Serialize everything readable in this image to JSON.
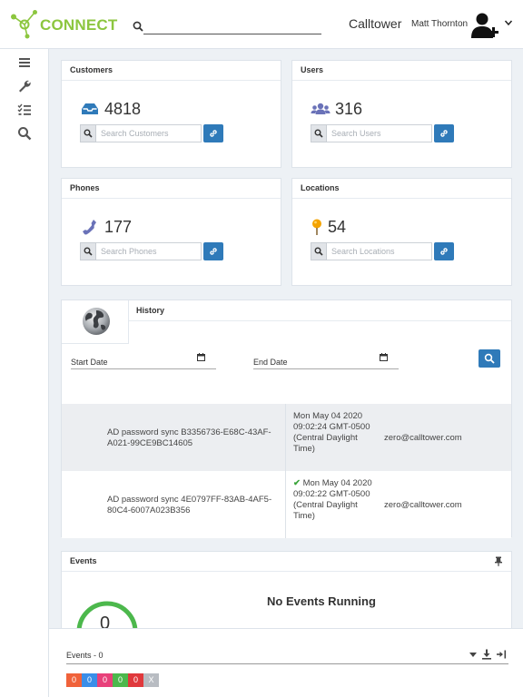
{
  "header": {
    "logo_text": "CONNECT",
    "search_placeholder": "",
    "brand": "Calltower",
    "user_name": "Matt Thornton"
  },
  "sidebar": {
    "items": [
      {
        "icon": "menu-icon"
      },
      {
        "icon": "wrench-icon"
      },
      {
        "icon": "checklist-icon"
      },
      {
        "icon": "search-icon"
      }
    ]
  },
  "stats": {
    "customers": {
      "title": "Customers",
      "value": "4818",
      "placeholder": "Search Customers",
      "icon": "inbox-icon"
    },
    "users": {
      "title": "Users",
      "value": "316",
      "placeholder": "Search Users",
      "icon": "users-icon"
    },
    "phones": {
      "title": "Phones",
      "value": "177",
      "placeholder": "Search Phones",
      "icon": "phone-icon"
    },
    "locations": {
      "title": "Locations",
      "value": "54",
      "placeholder": "Search Locations",
      "icon": "pin-icon"
    }
  },
  "history": {
    "title": "History",
    "start_date_label": "Start Date",
    "end_date_label": "End Date",
    "rows": [
      {
        "desc": "AD password sync B3356736-E68C-43AF-A021-99CE9BC14605",
        "check": "",
        "date": "Mon May 04 2020 09:02:24 GMT-0500 (Central Daylight Time)",
        "email": "zero@calltower.com"
      },
      {
        "desc": "AD password sync 4E0797FF-83AB-4AF5-80C4-6007A023B356",
        "check": "✔",
        "date": "Mon May 04 2020 09:02:22 GMT-0500 (Central Daylight Time)",
        "email": "zero@calltower.com"
      }
    ]
  },
  "events": {
    "title": "Events",
    "message": "No Events Running",
    "gauge_value": "0"
  },
  "footer": {
    "label": "Events - 0",
    "badges": [
      {
        "value": "0",
        "color": "#f0623a"
      },
      {
        "value": "0",
        "color": "#3a8ee8"
      },
      {
        "value": "0",
        "color": "#e8407a"
      },
      {
        "value": "0",
        "color": "#4cb84c"
      },
      {
        "value": "0",
        "color": "#e0383c"
      },
      {
        "value": "X",
        "color": "#b8bcc2"
      }
    ]
  },
  "colors": {
    "accent": "#2f7ab9",
    "brand_green": "#8cc63f",
    "icon_purple": "#6a72b8",
    "pin_orange": "#f4a300"
  }
}
